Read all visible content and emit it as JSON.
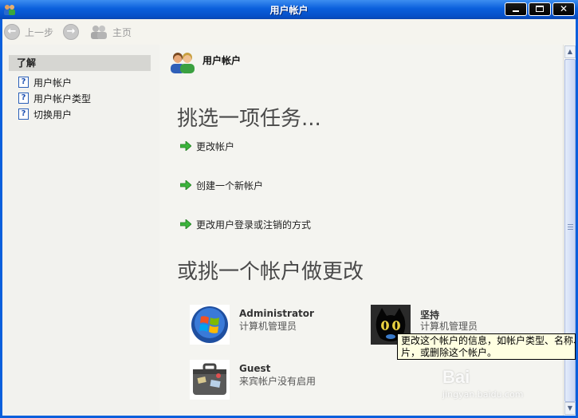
{
  "window": {
    "title": "用户帐户",
    "controls": {
      "close_glyph": "✕"
    }
  },
  "toolbar": {
    "back_label": "上一步",
    "home_label": "主页"
  },
  "left_pane": {
    "header": "了解",
    "items": [
      {
        "label": "用户帐户"
      },
      {
        "label": "用户帐户类型"
      },
      {
        "label": "切换用户"
      }
    ]
  },
  "main": {
    "header_title": "用户帐户",
    "pick_task_heading": "挑选一项任务...",
    "tasks": [
      {
        "label": "更改帐户"
      },
      {
        "label": "创建一个新帐户"
      },
      {
        "label": "更改用户登录或注销的方式"
      }
    ],
    "pick_account_heading": "或挑一个帐户做更改",
    "accounts": [
      {
        "name": "Administrator",
        "desc": "计算机管理员",
        "icon": "windows-logo-icon"
      },
      {
        "name": "坚持",
        "desc": "计算机管理员",
        "icon": "black-cat-avatar"
      },
      {
        "name": "Guest",
        "desc": "来宾帐户没有启用",
        "icon": "suitcase-icon"
      }
    ]
  },
  "tooltip": {
    "line1": "更改这个帐户的信息，如帐户类型、名称、",
    "line2": "片，或删除这个帐户。"
  },
  "watermark": {
    "main": "Bai",
    "sub": "jingyan.baidu.com"
  },
  "colors": {
    "titlebar": "#0a5fdc",
    "task_arrow": "#3cb43c",
    "tooltip_bg": "#ffffe1"
  }
}
